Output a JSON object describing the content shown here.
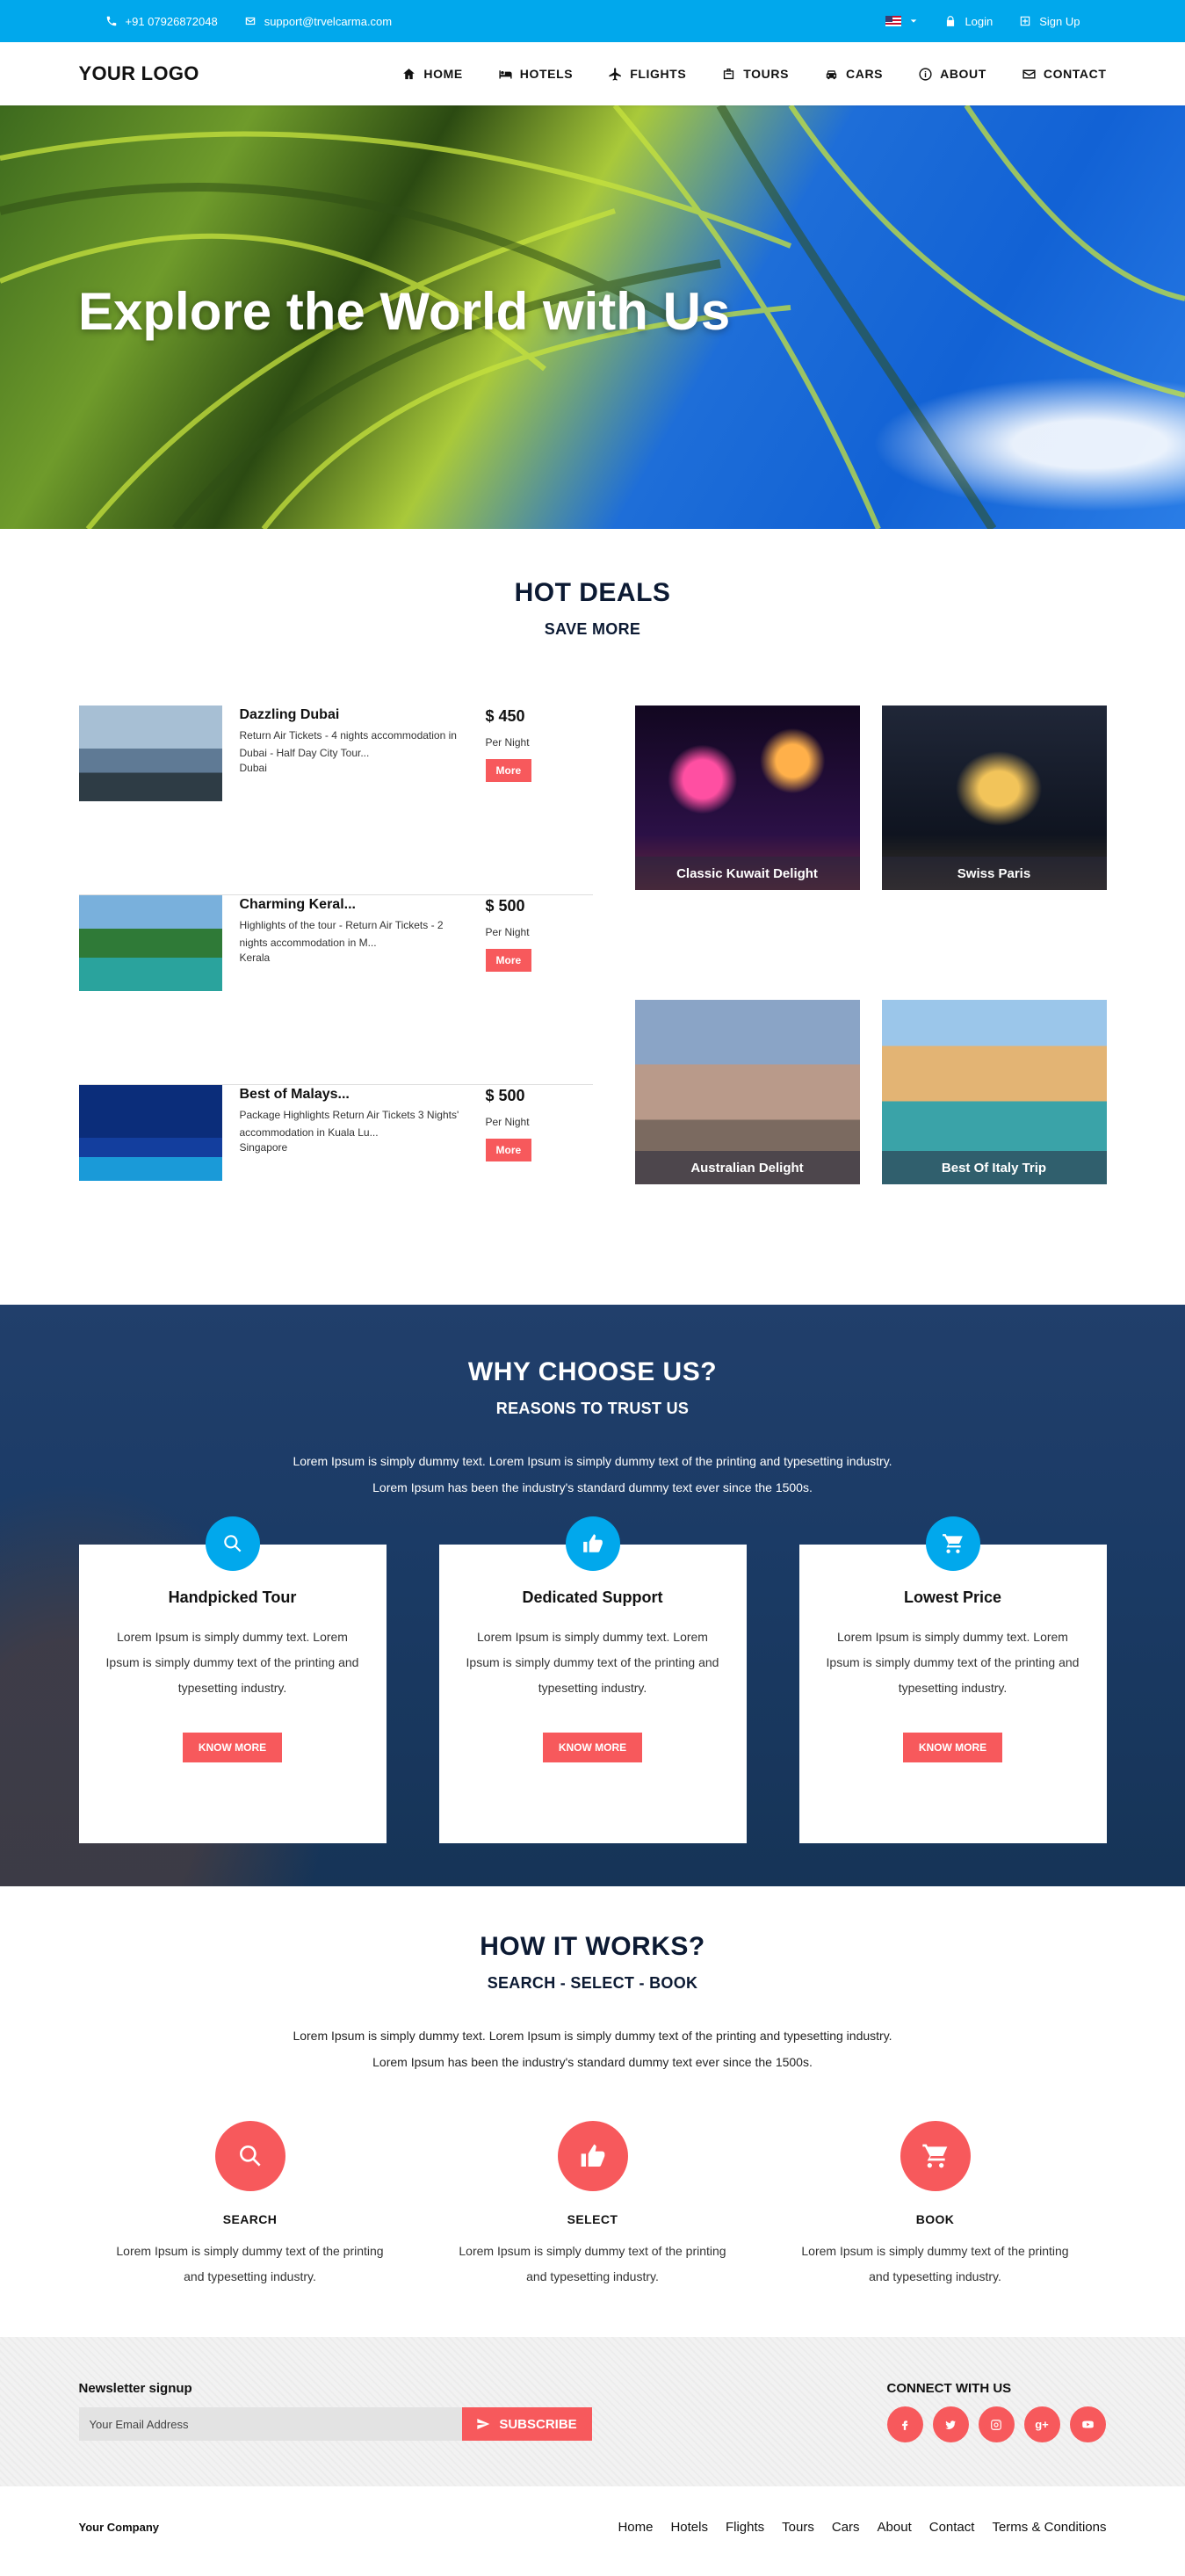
{
  "topbar": {
    "phone": "+91 07926872048",
    "email": "support@trvelcarma.com",
    "login": "Login",
    "signup": "Sign Up"
  },
  "navbar": {
    "logo": "YOUR LOGO",
    "items": [
      "HOME",
      "HOTELS",
      "FLIGHTS",
      "TOURS",
      "CARS",
      "ABOUT",
      "CONTACT"
    ]
  },
  "hero": {
    "title": "Explore the World with Us"
  },
  "hot_deals": {
    "title": "HOT DEALS",
    "subtitle": "SAVE MORE",
    "deals": [
      {
        "title": "Dazzling Dubai",
        "desc": "Return Air Tickets - 4 nights accommodation in Dubai - Half Day City Tour...",
        "location": "Dubai",
        "price": "$ 450",
        "per": "Per Night",
        "button": "More"
      },
      {
        "title": "Charming Keral...",
        "desc": "Highlights of the tour - Return Air Tickets - 2 nights accommodation in M...",
        "location": "Kerala",
        "price": "$ 500",
        "per": "Per Night",
        "button": "More"
      },
      {
        "title": "Best of Malays...",
        "desc": "Package Highlights Return Air Tickets 3 Nights' accommodation in Kuala Lu...",
        "location": "Singapore",
        "price": "$ 500",
        "per": "Per Night",
        "button": "More"
      }
    ],
    "tiles": [
      "Classic Kuwait Delight",
      "Swiss Paris",
      "Australian Delight",
      "Best Of Italy Trip"
    ]
  },
  "why": {
    "title": "WHY CHOOSE US?",
    "subtitle": "REASONS TO TRUST US",
    "intro1": "Lorem Ipsum is simply dummy text. Lorem Ipsum is simply dummy text of the printing and typesetting industry.",
    "intro2": "Lorem Ipsum has been the industry's standard dummy text ever since the 1500s.",
    "cards": [
      {
        "title": "Handpicked Tour",
        "text": "Lorem Ipsum is simply dummy text. Lorem Ipsum is simply dummy text of the printing and typesetting industry.",
        "button": "KNOW MORE"
      },
      {
        "title": "Dedicated Support",
        "text": "Lorem Ipsum is simply dummy text. Lorem Ipsum is simply dummy text of the printing and typesetting industry.",
        "button": "KNOW MORE"
      },
      {
        "title": "Lowest Price",
        "text": "Lorem Ipsum is simply dummy text. Lorem Ipsum is simply dummy text of the printing and typesetting industry.",
        "button": "KNOW MORE"
      }
    ]
  },
  "how": {
    "title": "HOW IT WORKS?",
    "subtitle": "SEARCH - SELECT - BOOK",
    "intro1": "Lorem Ipsum is simply dummy text. Lorem Ipsum is simply dummy text of the printing and typesetting industry.",
    "intro2": "Lorem Ipsum has been the industry's standard dummy text ever since the 1500s.",
    "steps": [
      {
        "title": "SEARCH",
        "text": "Lorem Ipsum is simply dummy text of the printing and typesetting industry."
      },
      {
        "title": "SELECT",
        "text": "Lorem Ipsum is simply dummy text of the printing and typesetting industry."
      },
      {
        "title": "BOOK",
        "text": "Lorem Ipsum is simply dummy text of the printing and typesetting industry."
      }
    ]
  },
  "newsletter": {
    "title": "Newsletter signup",
    "placeholder": "Your Email Address",
    "button": "SUBSCRIBE",
    "connect_title": "CONNECT WITH US",
    "socials": [
      "f",
      "t",
      "ig",
      "g+",
      "yt"
    ]
  },
  "footer": {
    "company": "Your Company",
    "links": [
      "Home",
      "Hotels",
      "Flights",
      "Tours",
      "Cars",
      "About",
      "Contact",
      "Terms & Conditions"
    ]
  },
  "colors": {
    "topbar": "#01a8ec",
    "accent": "#f7595c",
    "dark_text": "#0c1a33"
  }
}
